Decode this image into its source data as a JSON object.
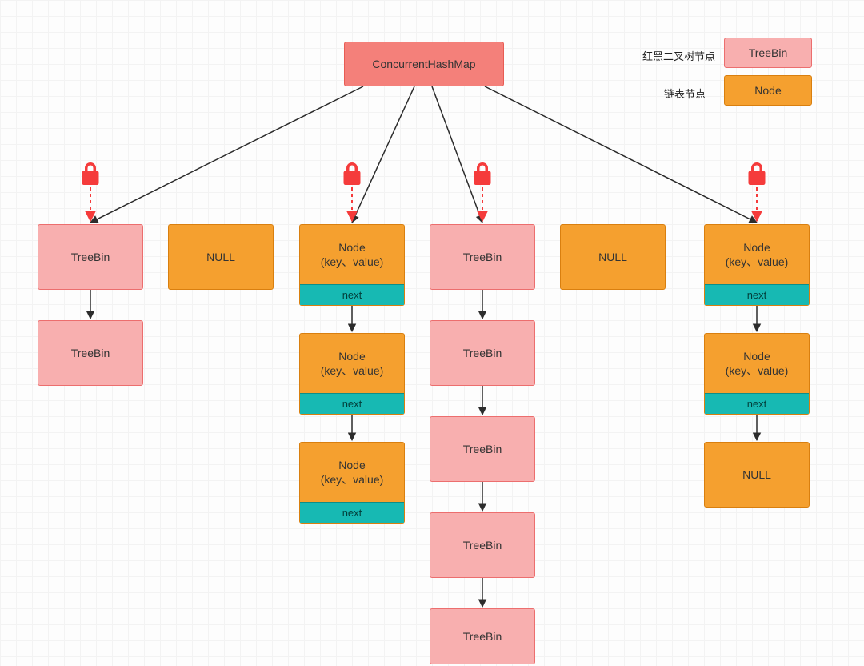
{
  "title": "ConcurrentHashMap",
  "legend": {
    "rb_label": "红黑二叉树节点",
    "rb_box": "TreeBin",
    "list_label": "链表节点",
    "list_box": "Node"
  },
  "labels": {
    "treebin": "TreeBin",
    "null": "NULL",
    "node_kv": "Node\n(key、value)",
    "next": "next"
  },
  "colors": {
    "root": "#f4807a",
    "treebin": "#f8afaf",
    "orange": "#f5a02f",
    "teal": "#17b9b3",
    "lock": "#f53b3b",
    "arrow": "#2c2c2c"
  }
}
